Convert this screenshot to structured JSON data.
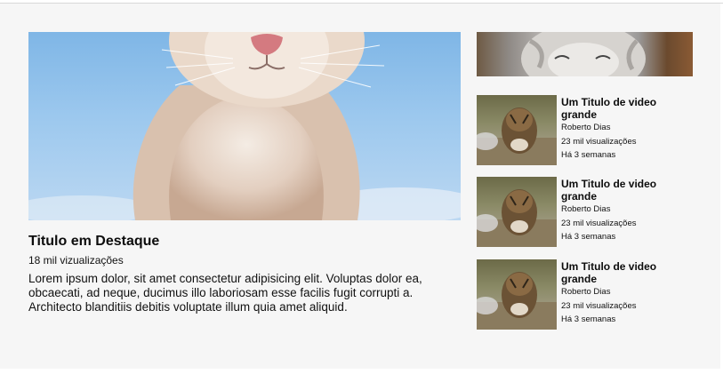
{
  "featured": {
    "title": "Titulo em Destaque",
    "views": "18 mil vizualizações",
    "description": "Lorem ipsum dolor, sit amet consectetur adipisicing elit. Voluptas dolor ea, obcaecati, ad neque, ducimus illo laboriosam esse facilis fugit corrupti a. Architecto blanditiis debitis voluptate illum quia amet aliquid."
  },
  "videos": [
    {
      "title": "Um Titulo de video grande",
      "author": "Roberto Dias",
      "views": "23 mil visualizações",
      "age": "Há 3 semanas"
    },
    {
      "title": "Um Titulo de video grande",
      "author": "Roberto Dias",
      "views": "23 mil visualizações",
      "age": "Há 3 semanas"
    },
    {
      "title": "Um Titulo de video grande",
      "author": "Roberto Dias",
      "views": "23 mil visualizações",
      "age": "Há 3 semanas"
    }
  ]
}
